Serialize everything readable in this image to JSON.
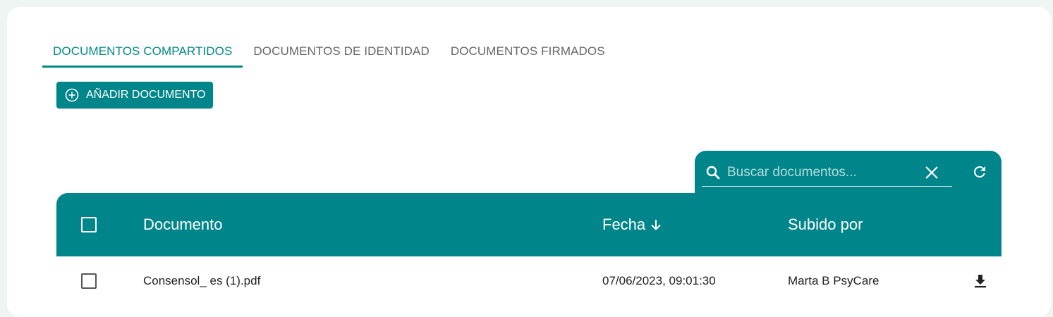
{
  "tabs": [
    {
      "label": "DOCUMENTOS COMPARTIDOS",
      "active": true
    },
    {
      "label": "DOCUMENTOS DE IDENTIDAD",
      "active": false
    },
    {
      "label": "DOCUMENTOS FIRMADOS",
      "active": false
    }
  ],
  "add_button": {
    "label": "AÑADIR DOCUMENTO",
    "icon": "add-circle-icon"
  },
  "search": {
    "placeholder": "Buscar documentos...",
    "value": ""
  },
  "table": {
    "headers": {
      "document": "Documento",
      "date": "Fecha",
      "uploaded_by": "Subido por"
    },
    "sort": {
      "column": "date",
      "direction": "descending"
    },
    "rows": [
      {
        "document": "Consensol_ es (1).pdf",
        "date": "07/06/2023, 09:01:30",
        "uploaded_by": "Marta B PsyCare",
        "checked": false
      }
    ]
  },
  "colors": {
    "accent": "#00868a",
    "background": "#eef5f3",
    "card": "#ffffff"
  }
}
